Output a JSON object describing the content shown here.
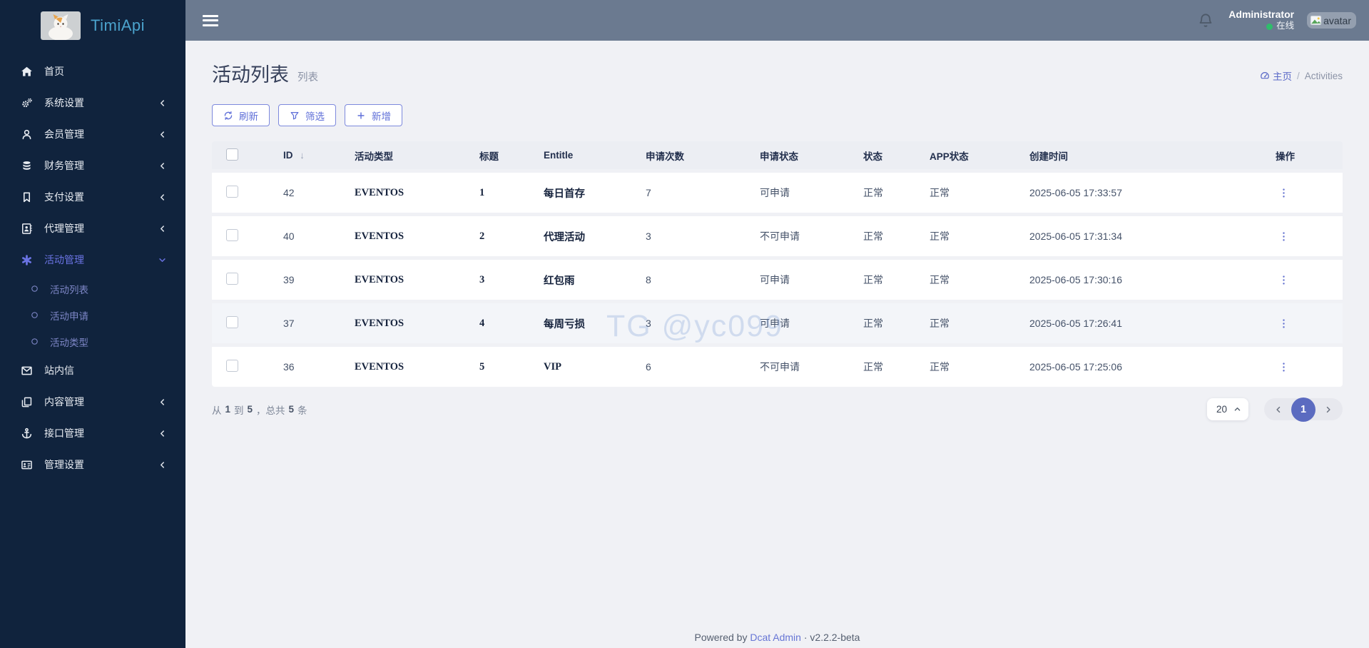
{
  "app": {
    "title": "TimiApi"
  },
  "topbar": {
    "username": "Administrator",
    "status": "在线",
    "avatar_alt": "avatar"
  },
  "sidebar": {
    "items": [
      {
        "label": "首页",
        "icon": "home-icon"
      },
      {
        "label": "系统设置",
        "icon": "gears-icon",
        "chevron": "left"
      },
      {
        "label": "会员管理",
        "icon": "user-icon",
        "chevron": "left"
      },
      {
        "label": "财务管理",
        "icon": "database-icon",
        "chevron": "left"
      },
      {
        "label": "支付设置",
        "icon": "bookmark-icon",
        "chevron": "left"
      },
      {
        "label": "代理管理",
        "icon": "address-book-icon",
        "chevron": "left"
      },
      {
        "label": "活动管理",
        "icon": "asterisk-icon",
        "chevron": "down",
        "active": true,
        "children": [
          {
            "label": "活动列表",
            "icon": "circle-icon"
          },
          {
            "label": "活动申请",
            "icon": "circle-icon"
          },
          {
            "label": "活动类型",
            "icon": "circle-icon"
          }
        ]
      },
      {
        "label": "站内信",
        "icon": "envelope-icon"
      },
      {
        "label": "内容管理",
        "icon": "copy-icon",
        "chevron": "left"
      },
      {
        "label": "接口管理",
        "icon": "anchor-icon",
        "chevron": "left"
      },
      {
        "label": "管理设置",
        "icon": "id-card-icon",
        "chevron": "left"
      }
    ]
  },
  "page": {
    "title": "活动列表",
    "subtitle": "列表",
    "breadcrumb": {
      "home": "主页",
      "separator": "/",
      "current": "Activities"
    }
  },
  "toolbar": {
    "refresh": "刷新",
    "filter": "筛选",
    "add": "新增"
  },
  "table": {
    "columns": [
      "ID",
      "活动类型",
      "标题",
      "Entitle",
      "申请次数",
      "申请状态",
      "状态",
      "APP状态",
      "创建时间",
      "操作"
    ],
    "sorted_column": "ID",
    "rows": [
      {
        "id": "42",
        "type": "EVENTOS",
        "title": "1",
        "entitle": "每日首存",
        "apply_count": "7",
        "apply_status": "可申请",
        "status": "正常",
        "app_status": "正常",
        "created_at": "2025-06-05 17:33:57",
        "highlighted": false
      },
      {
        "id": "40",
        "type": "EVENTOS",
        "title": "2",
        "entitle": "代理活动",
        "apply_count": "3",
        "apply_status": "不可申请",
        "status": "正常",
        "app_status": "正常",
        "created_at": "2025-06-05 17:31:34",
        "highlighted": false
      },
      {
        "id": "39",
        "type": "EVENTOS",
        "title": "3",
        "entitle": "红包雨",
        "apply_count": "8",
        "apply_status": "可申请",
        "status": "正常",
        "app_status": "正常",
        "created_at": "2025-06-05 17:30:16",
        "highlighted": false
      },
      {
        "id": "37",
        "type": "EVENTOS",
        "title": "4",
        "entitle": "每周亏损",
        "apply_count": "3",
        "apply_status": "可申请",
        "status": "正常",
        "app_status": "正常",
        "created_at": "2025-06-05 17:26:41",
        "highlighted": true
      },
      {
        "id": "36",
        "type": "EVENTOS",
        "title": "5",
        "entitle": "VIP",
        "apply_count": "6",
        "apply_status": "不可申请",
        "status": "正常",
        "app_status": "正常",
        "created_at": "2025-06-05 17:25:06",
        "highlighted": false
      }
    ]
  },
  "pagination": {
    "summary": {
      "prefix": "从",
      "from": "1",
      "mid": "到",
      "to": "5",
      "mid2": "，总共",
      "total": "5",
      "suffix": "条"
    },
    "page_size": "20",
    "current_page": "1"
  },
  "footer": {
    "powered_by": "Powered by",
    "brand": "Dcat Admin",
    "separator": "·",
    "version": "v2.2.2-beta"
  },
  "watermark": {
    "text": "TG @yc099"
  },
  "colors": {
    "accent": "#5f6fd8",
    "sidebar_bg": "#10233d",
    "topbar_bg": "#6b7a90",
    "online_green": "#2fbd6b",
    "pager_active": "#5b6bc0",
    "logo_text": "#4ba3cd"
  }
}
